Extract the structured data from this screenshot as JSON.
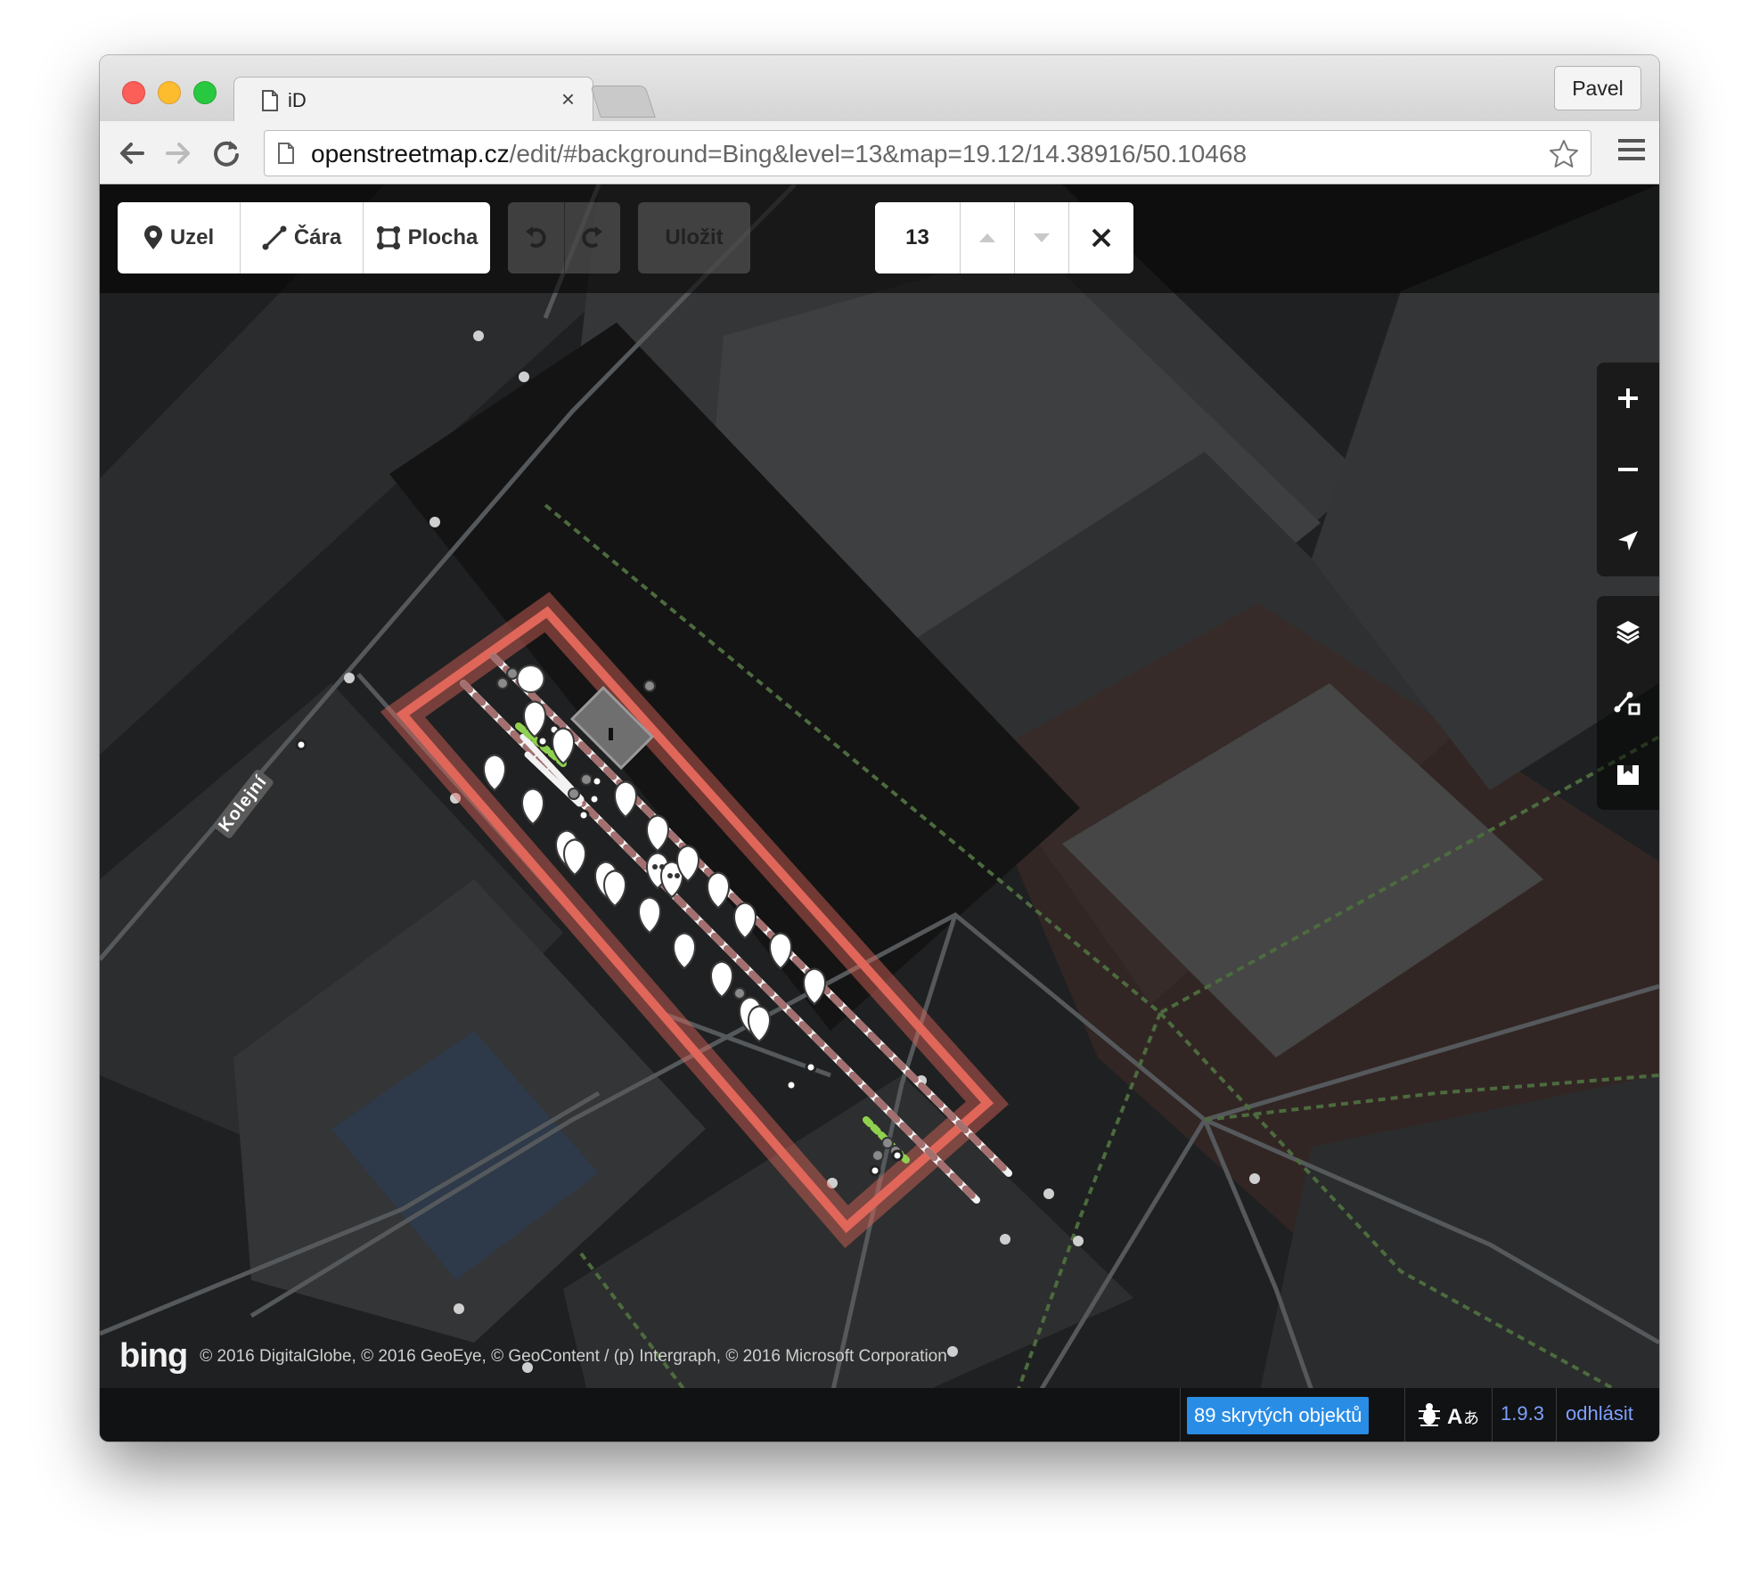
{
  "browser": {
    "tab_title": "iD",
    "profile_name": "Pavel",
    "url_host": "openstreetmap.cz",
    "url_path": "/edit/#background=Bing&level=13&map=19.12/14.38916/50.10468",
    "icons": [
      "document-icon",
      "close-icon",
      "back-arrow-icon",
      "forward-arrow-icon",
      "reload-icon",
      "star-icon",
      "hamburger-menu-icon"
    ]
  },
  "editor": {
    "modes": [
      {
        "label": "Uzel",
        "icon": "point-marker-icon"
      },
      {
        "label": "Čára",
        "icon": "line-icon"
      },
      {
        "label": "Plocha",
        "icon": "area-icon"
      }
    ],
    "save_label": "Uložit",
    "level_value": "13",
    "street_label": "Kolejní",
    "map_controls": [
      "zoom-in-icon",
      "zoom-out-icon",
      "geolocate-icon",
      "layers-icon",
      "map-data-icon",
      "help-icon"
    ],
    "colors": {
      "area_outline": "#e0665a",
      "rail": "#b48686",
      "footpath_green": "#8fd14f",
      "accent_blue": "#2a8de5"
    }
  },
  "attribution": {
    "logo": "bing",
    "text": "© 2016 DigitalGlobe, © 2016 GeoEye, © GeoContent / (p) Intergraph, © 2016 Microsoft Corporation"
  },
  "footer": {
    "hidden_features": "89 skrytých objektů",
    "version": "1.9.3",
    "logout": "odhlásit"
  }
}
